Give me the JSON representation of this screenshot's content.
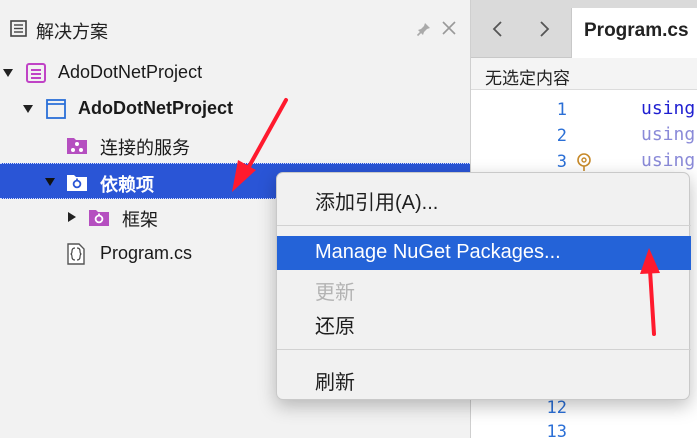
{
  "solution_pane": {
    "title": "解决方案",
    "tree": [
      {
        "label": "AdoDotNetProject",
        "level": 0,
        "expanded": true
      },
      {
        "label": "AdoDotNetProject",
        "level": 1,
        "expanded": true
      },
      {
        "label": "连接的服务",
        "level": 2
      },
      {
        "label": "依赖项",
        "level": 2,
        "expanded": true,
        "selected": true
      },
      {
        "label": "框架",
        "level": 3,
        "expanded": false
      },
      {
        "label": "Program.cs",
        "level": 2
      }
    ]
  },
  "editor": {
    "active_tab": "Program.cs",
    "breadcrumb": "无选定内容",
    "line_numbers": [
      "1",
      "2",
      "3",
      "12",
      "13"
    ],
    "code_lines": [
      "using",
      "using",
      "using"
    ]
  },
  "context_menu": {
    "items": [
      {
        "label": "添加引用(A)...",
        "state": "normal"
      },
      {
        "label": "Manage NuGet Packages...",
        "state": "highlighted"
      },
      {
        "label": "更新",
        "state": "disabled"
      },
      {
        "label": "还原",
        "state": "normal"
      },
      {
        "label": "刷新",
        "state": "normal"
      }
    ]
  },
  "colors": {
    "selection": "#2a55d6",
    "menu_highlight": "#2463d8",
    "annotation_arrow": "#ff1a2e",
    "project_icon": "#c043c6"
  }
}
